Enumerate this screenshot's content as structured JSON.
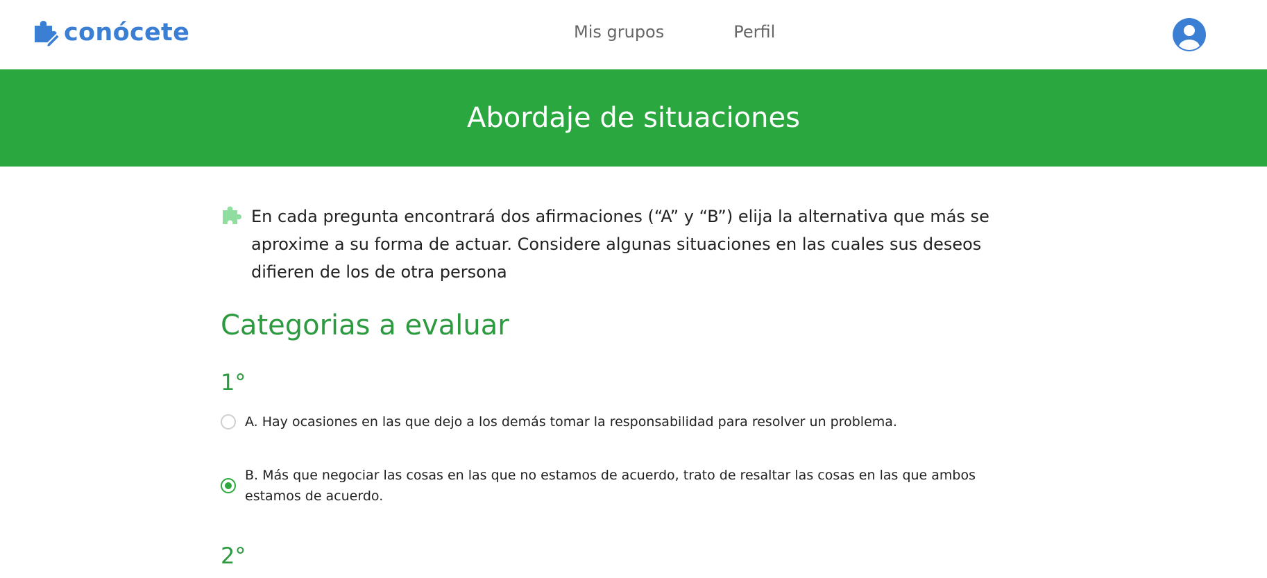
{
  "header": {
    "brand": "conócete",
    "nav": [
      "Mis grupos",
      "Perfil"
    ]
  },
  "banner": {
    "title": "Abordaje de situaciones"
  },
  "intro": {
    "text": "En cada pregunta encontrará dos afirmaciones (“A” y “B”) elija la alternativa que más se aproxime a su forma de actuar. Considere algunas situaciones en las cuales sus deseos difieren de los de otra persona"
  },
  "section_title": "Categorias a evaluar",
  "questions": [
    {
      "number": "1°",
      "options": [
        {
          "text": "A. Hay ocasiones en las que dejo a los demás tomar la responsabilidad para resolver un problema.",
          "selected": false
        },
        {
          "text": "B. Más que negociar las cosas en las que no estamos de acuerdo, trato de resaltar las cosas en las que ambos estamos de acuerdo.",
          "selected": true
        }
      ]
    },
    {
      "number": "2°"
    }
  ],
  "colors": {
    "brand_blue": "#3b7fd4",
    "accent_green": "#2aa83f",
    "heading_green": "#2c9a3e",
    "puzzle_light_green": "#8fdea0"
  }
}
